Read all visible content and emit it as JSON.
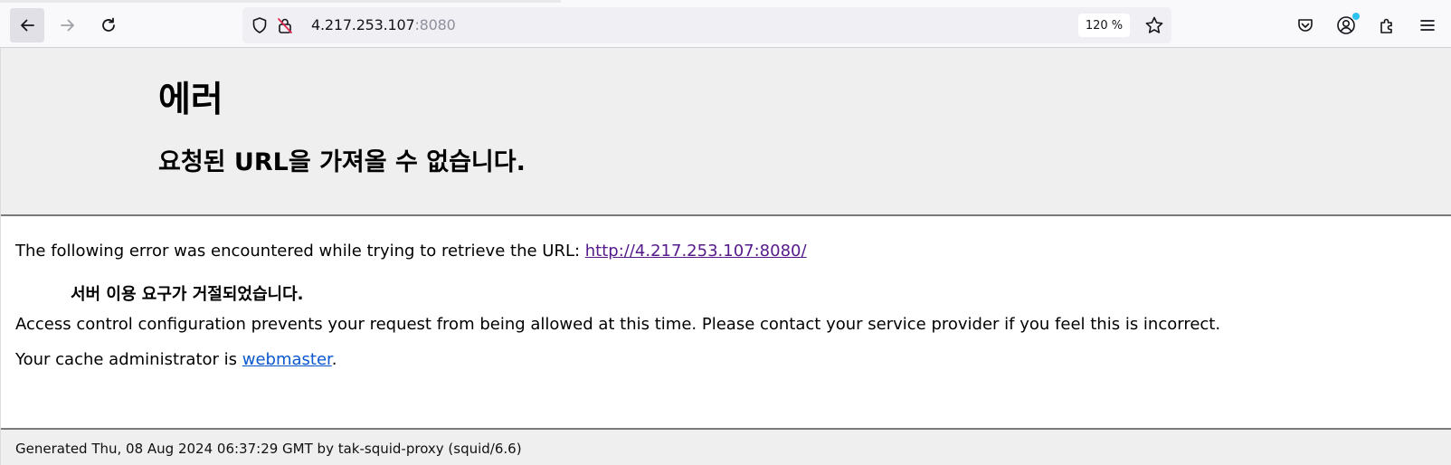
{
  "browser": {
    "url_host": "4.217.253.107",
    "url_port": ":8080",
    "zoom_level": "120 %",
    "icons": {
      "back": "back-arrow-icon",
      "forward": "forward-arrow-icon",
      "reload": "reload-icon",
      "tracking_protection": "shield-icon",
      "connection_insecure": "insecure-lock-icon",
      "bookmark": "star-icon",
      "pocket": "pocket-icon",
      "account": "account-icon",
      "extensions": "extensions-icon",
      "menu": "hamburger-menu-icon"
    },
    "colors": {
      "toolbar_bg": "#f9f9fb",
      "urlbar_bg": "#f0f0f4",
      "account_badge": "#2cc3f0"
    }
  },
  "page": {
    "title": "에러",
    "subtitle": "요청된 URL을 가져올 수 없습니다.",
    "error_line_prefix": "The following error was encountered while trying to retrieve the URL: ",
    "error_url": "http://4.217.253.107:8080/",
    "error_reason": "서버 이용 요구가 거절되었습니다.",
    "description": "Access control configuration prevents your request from being allowed at this time. Please contact your service provider if you feel this is incorrect.",
    "admin_prefix": "Your cache administrator is ",
    "admin_link": "webmaster",
    "admin_suffix": ".",
    "footer": "Generated Thu, 08 Aug 2024 06:37:29 GMT by tak-squid-proxy (squid/6.6)",
    "colors": {
      "header_bg": "#efefef",
      "rule": "#7a7a7a",
      "visited_link": "#551a8b",
      "link": "#0b57d0"
    }
  }
}
